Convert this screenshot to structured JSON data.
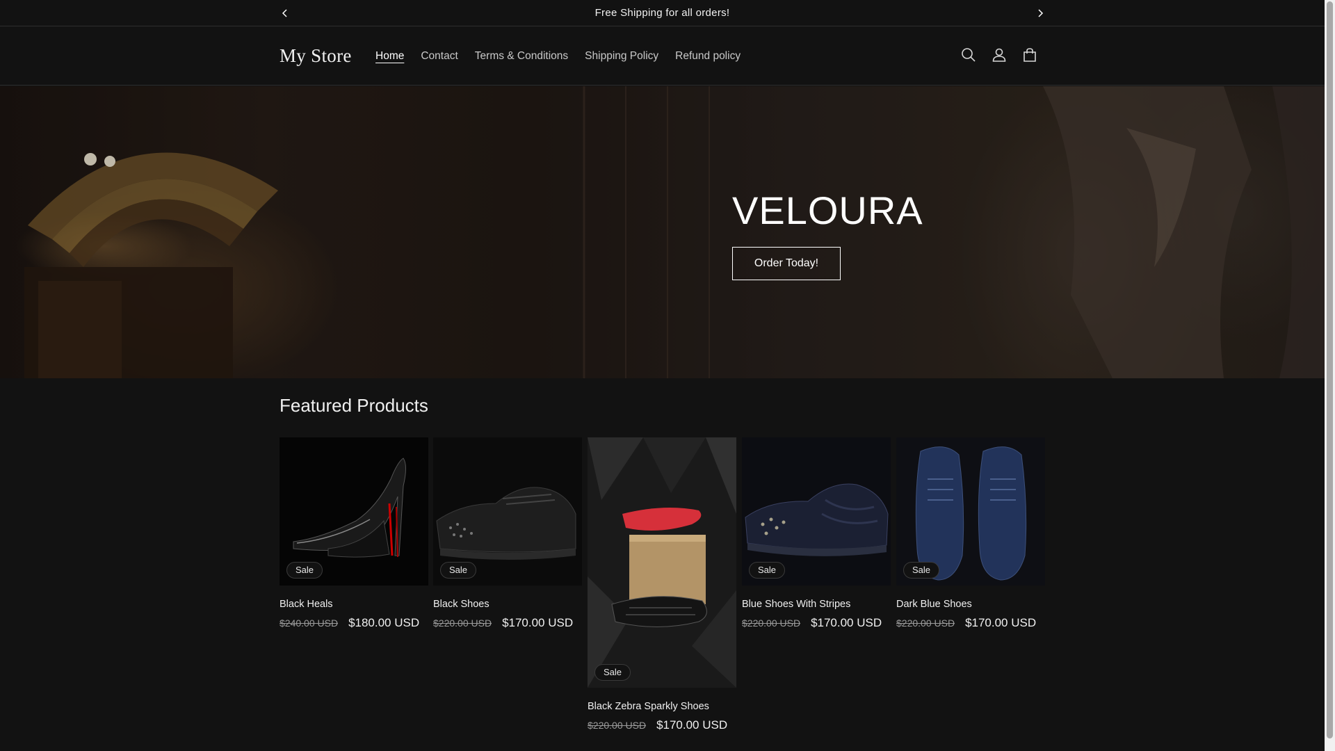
{
  "announcement": {
    "text": "Free Shipping for all orders!",
    "prev_icon": "chevron-left-icon",
    "next_icon": "chevron-right-icon"
  },
  "header": {
    "logo": "My Store",
    "nav": [
      "Home",
      "Contact",
      "Terms & Conditions",
      "Shipping Policy",
      "Refund policy"
    ],
    "active_nav": "Home",
    "icons": [
      "search-icon",
      "account-icon",
      "cart-icon"
    ]
  },
  "hero": {
    "title": "VELOURA",
    "button": "Order Today!"
  },
  "featured": {
    "title": "Featured Products",
    "products": [
      {
        "title": "Black Heals",
        "old_price": "$240.00 USD",
        "price": "$180.00 USD",
        "badge": "Sale"
      },
      {
        "title": "Black Shoes",
        "old_price": "$220.00 USD",
        "price": "$170.00 USD",
        "badge": "Sale"
      },
      {
        "title": "Black Zebra Sparkly Shoes",
        "old_price": "$220.00 USD",
        "price": "$170.00 USD",
        "badge": "Sale"
      },
      {
        "title": "Blue Shoes With Stripes",
        "old_price": "$220.00 USD",
        "price": "$170.00 USD",
        "badge": "Sale"
      },
      {
        "title": "Dark Blue Shoes",
        "old_price": "$220.00 USD",
        "price": "$170.00 USD",
        "badge": "Sale"
      }
    ]
  },
  "colors": {
    "background": "#121212",
    "text": "#ffffff",
    "muted": "#9a9a9a"
  }
}
